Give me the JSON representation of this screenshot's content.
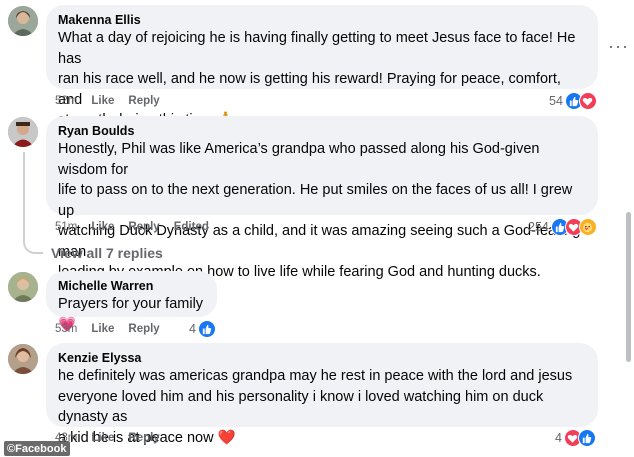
{
  "comments": [
    {
      "author": "Makenna Ellis",
      "lines": [
        "What a day of rejoicing he is having finally getting to meet Jesus face to face! He has",
        "ran his race well, and he now is getting his reward! Praying for peace, comfort, and",
        "strength during this time 🙏"
      ],
      "time": "52m",
      "like": "Like",
      "reply": "Reply",
      "reaction_count": "54",
      "reactions": [
        "like-icon",
        "love-icon"
      ]
    },
    {
      "author": "Ryan Boulds",
      "lines": [
        "Honestly, Phil was like America’s grandpa who passed along his God-given wisdom for",
        "life to pass on to the next generation. He put smiles on the faces of us all! I grew up",
        "watching Duck Dynasty as a child, and it was amazing seeing such a God-fearing man",
        "leading by example on how to live life while fearing God and hunting ducks."
      ],
      "time": "51m",
      "like": "Like",
      "reply": "Reply",
      "edited": "Edited",
      "reaction_count": "254",
      "reactions": [
        "like-icon",
        "love-icon",
        "care-icon"
      ]
    },
    {
      "author": "Michelle Warren",
      "lines": [
        "Prayers for your family💗"
      ],
      "time": "53m",
      "like": "Like",
      "reply": "Reply",
      "reaction_count": "4",
      "reactions": [
        "like-icon"
      ]
    },
    {
      "author": "Kenzie Elyssa",
      "lines": [
        "he definitely was americas grandpa may he rest in peace with the lord and jesus",
        "everyone loved him and his personality i know i loved watching him on duck dynasty as",
        "a kid he is at peace now ❤️"
      ],
      "time": "43m",
      "like": "Like",
      "reply": "Reply",
      "reaction_count": "4",
      "reactions": [
        "love-icon",
        "like-icon"
      ]
    }
  ],
  "view_replies": "View all 7 replies",
  "watermark": "©Facebook",
  "colors": {
    "bubble": "#f0f2f5",
    "like": "#1877f2",
    "love": "#f33e58",
    "care": "#f7b125",
    "meta": "#65676b"
  }
}
